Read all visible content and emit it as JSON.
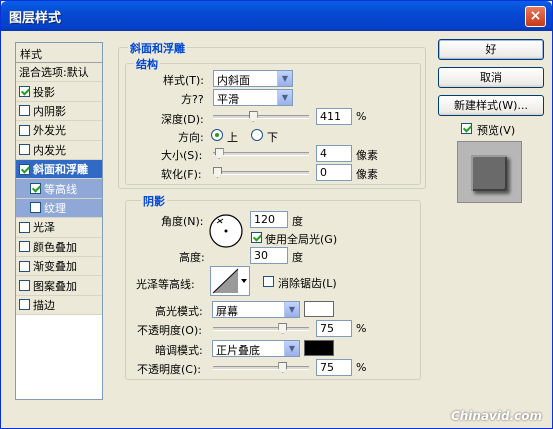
{
  "window": {
    "title": "图层样式",
    "close": "×"
  },
  "style_list": {
    "header": "样式",
    "items": [
      {
        "label": "混合选项:默认",
        "check": null,
        "state": "normal"
      },
      {
        "label": "投影",
        "check": true,
        "state": "normal"
      },
      {
        "label": "内阴影",
        "check": false,
        "state": "normal"
      },
      {
        "label": "外发光",
        "check": false,
        "state": "normal"
      },
      {
        "label": "内发光",
        "check": false,
        "state": "normal"
      },
      {
        "label": "斜面和浮雕",
        "check": true,
        "state": "selected"
      },
      {
        "label": "等高线",
        "check": true,
        "state": "sub"
      },
      {
        "label": "纹理",
        "check": false,
        "state": "sub"
      },
      {
        "label": "光泽",
        "check": false,
        "state": "normal"
      },
      {
        "label": "颜色叠加",
        "check": false,
        "state": "normal"
      },
      {
        "label": "渐变叠加",
        "check": false,
        "state": "normal"
      },
      {
        "label": "图案叠加",
        "check": false,
        "state": "normal"
      },
      {
        "label": "描边",
        "check": false,
        "state": "normal"
      }
    ]
  },
  "bevel": {
    "section_title": "斜面和浮雕",
    "structure_title": "结构",
    "style_label": "样式(T):",
    "style_value": "内斜面",
    "method_label": "方??",
    "method_value": "平滑",
    "depth_label": "深度(D):",
    "depth_value": "411",
    "depth_unit": "%",
    "depth_level": 0.411,
    "direction_label": "方向:",
    "direction_up": "上",
    "direction_down": "下",
    "direction_selected": "up",
    "size_label": "大小(S):",
    "size_value": "4",
    "size_unit": "像素",
    "size_level": 0.02,
    "soften_label": "软化(F):",
    "soften_value": "0",
    "soften_unit": "像素",
    "soften_level": 0.0
  },
  "shading": {
    "title": "阴影",
    "angle_label": "角度(N):",
    "angle_value": "120",
    "angle_unit": "度",
    "global_light_label": "使用全局光(G)",
    "global_light_checked": true,
    "altitude_label": "高度:",
    "altitude_value": "30",
    "altitude_unit": "度",
    "gloss_label": "光泽等高线:",
    "antialias_label": "消除锯齿(L)",
    "antialias_checked": false,
    "highlight_mode_label": "高光模式:",
    "highlight_mode_value": "屏幕",
    "highlight_color": "#ffffff",
    "highlight_opacity_label": "不透明度(O):",
    "highlight_opacity_value": "75",
    "highlight_opacity_level": 0.75,
    "shadow_mode_label": "暗调模式:",
    "shadow_mode_value": "正片叠底",
    "shadow_color": "#000000",
    "shadow_opacity_label": "不透明度(C):",
    "shadow_opacity_value": "75",
    "shadow_opacity_level": 0.75,
    "percent": "%"
  },
  "buttons": {
    "ok": "好",
    "cancel": "取消",
    "new_style": "新建样式(W)...",
    "preview_label": "预览(V)",
    "preview_checked": true
  },
  "watermark": "Chinavid.com"
}
